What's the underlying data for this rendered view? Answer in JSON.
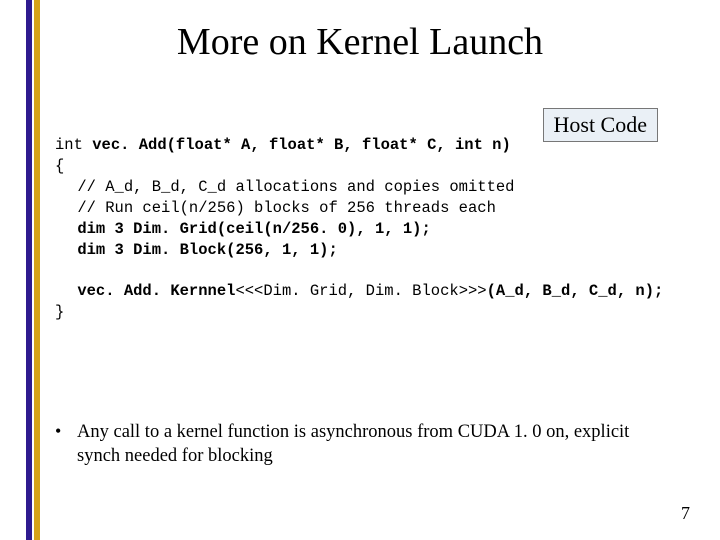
{
  "title": "More on Kernel Launch",
  "host_badge": "Host Code",
  "code": {
    "sig_plain": "int ",
    "sig_bold": "vec. Add(float* A, float* B, float* C, int n)",
    "open_brace": "{",
    "c1": "// A_d, B_d, C_d allocations and copies omitted",
    "c2": "// Run ceil(n/256) blocks of 256 threads each",
    "d1": "dim 3 Dim. Grid(ceil(n/256. 0), 1, 1);",
    "d2": "dim 3 Dim. Block(256, 1, 1);",
    "call_bold1": "vec. Add. Kernnel",
    "call_plain": "<<<Dim. Grid, Dim. Block>>>",
    "call_bold2": "(A_d, B_d, C_d, n);",
    "close_brace": "}"
  },
  "bullet": {
    "mark": "•",
    "text": "Any call to a kernel function is asynchronous from CUDA 1. 0 on, explicit synch needed for blocking"
  },
  "page_number": "7"
}
